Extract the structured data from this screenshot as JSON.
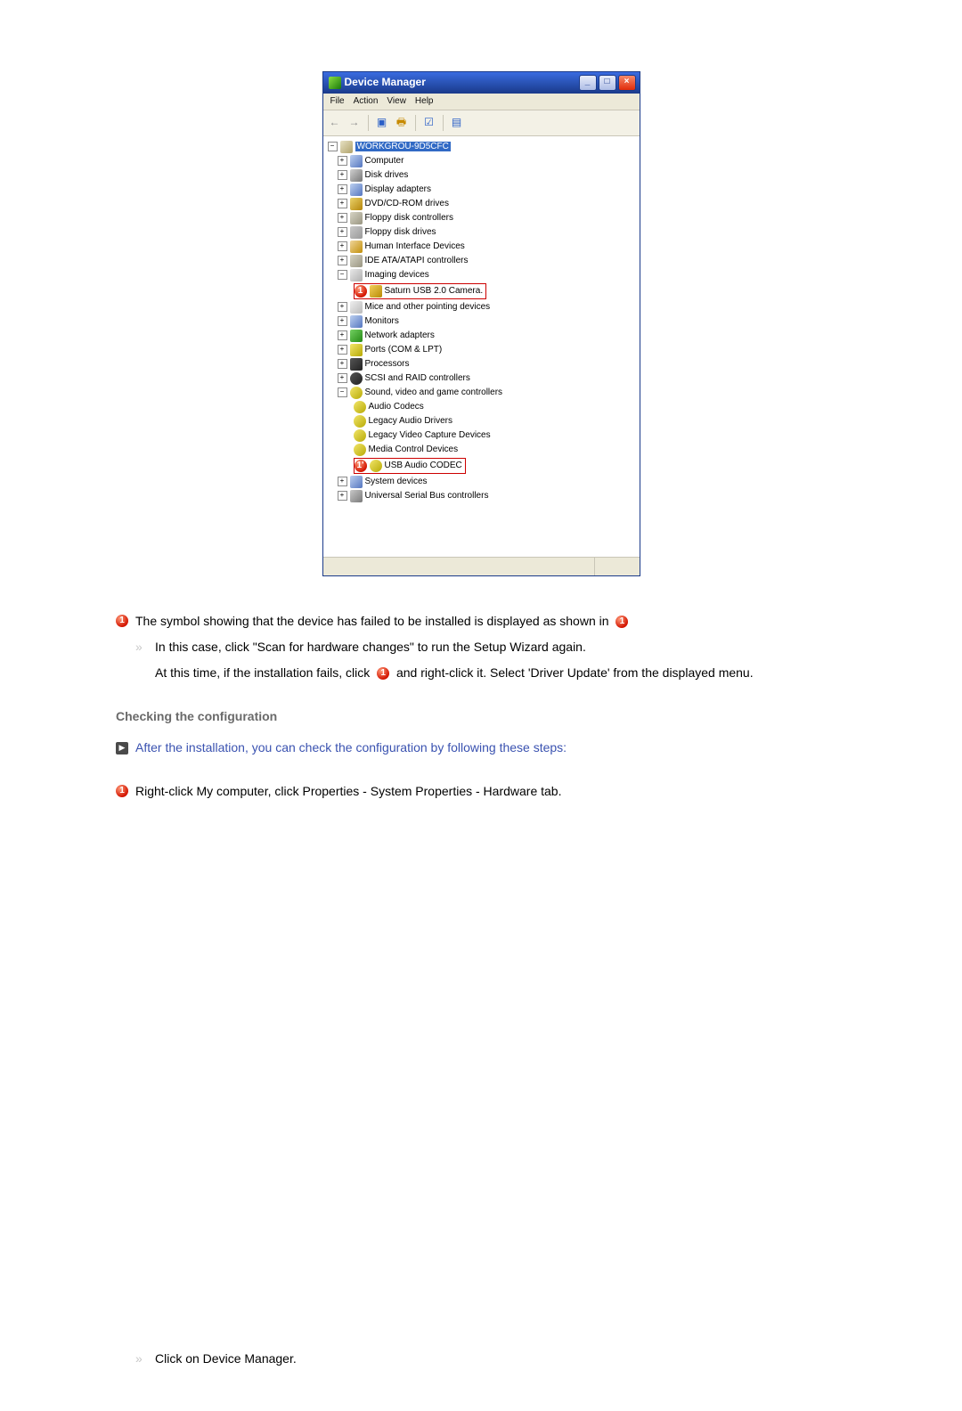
{
  "devmgr": {
    "title": "Device Manager",
    "menu": {
      "file": "File",
      "action": "Action",
      "view": "View",
      "help": "Help"
    },
    "root": "WORKGROU-9D5CFC",
    "nodes": {
      "computer": "Computer",
      "disk": "Disk drives",
      "display": "Display adapters",
      "dvd": "DVD/CD-ROM drives",
      "floppy_ctrl": "Floppy disk controllers",
      "floppy_drv": "Floppy disk drives",
      "hid": "Human Interface Devices",
      "ide": "IDE ATA/ATAPI controllers",
      "imaging": "Imaging devices",
      "camera": "Saturn USB 2.0 Camera.",
      "mice": "Mice and other pointing devices",
      "monitors": "Monitors",
      "network": "Network adapters",
      "ports": "Ports (COM & LPT)",
      "processors": "Processors",
      "scsi": "SCSI and RAID controllers",
      "sound": "Sound, video and game controllers",
      "audio_codecs": "Audio Codecs",
      "legacy_audio": "Legacy Audio Drivers",
      "legacy_video": "Legacy Video Capture Devices",
      "media_ctrl": "Media Control Devices",
      "usb_audio": "USB Audio CODEC",
      "system": "System devices",
      "usb": "Universal Serial Bus controllers"
    }
  },
  "badges": {
    "one": "1",
    "one_prime": "1'"
  },
  "text": {
    "fail_line": "The symbol showing that the device has failed to be installed is displayed as shown in",
    "scan_line": "In this case, click \"Scan for hardware changes\" to run the Setup Wizard again.",
    "retry_a": "At this time, if the installation fails, click",
    "retry_b": "and right-click it. Select 'Driver Update' from the displayed menu.",
    "checking_title": "Checking the configuration",
    "after_install": "After the installation, you can check the configuration by following these steps:",
    "rc_mycomp": "Right-click My computer, click Properties - System Properties - Hardware tab.",
    "click_devmgr": "Click on Device Manager."
  }
}
